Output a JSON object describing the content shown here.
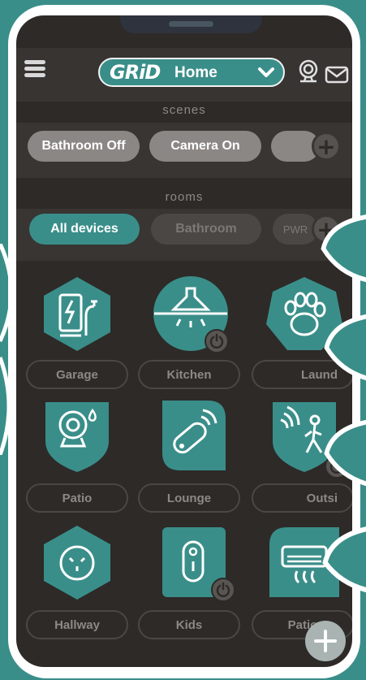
{
  "header": {
    "logo_text": "GRiD",
    "home_name": "Home",
    "menu_icon": "hamburger-menu-icon",
    "camera_icon": "webcam-icon",
    "mail_icon": "mail-icon"
  },
  "scenes": {
    "label": "scenes",
    "items": [
      {
        "label": "Bathroom Off"
      },
      {
        "label": "Camera On"
      },
      {
        "label": ""
      }
    ]
  },
  "rooms": {
    "label": "rooms",
    "filters": [
      {
        "label": "All devices",
        "active": true
      },
      {
        "label": "Bathroom",
        "active": false
      },
      {
        "label": "PWR",
        "active": false
      }
    ]
  },
  "devices": [
    {
      "room": "Garage",
      "icon": "ev-charger-icon",
      "shape": "hexagon",
      "power": false
    },
    {
      "room": "Kitchen",
      "icon": "range-hood-icon",
      "shape": "circle",
      "power": true
    },
    {
      "room": "Laundry",
      "display": "Laund",
      "icon": "pet-paw-icon",
      "shape": "heptagon",
      "power": true
    },
    {
      "room": "Patio",
      "icon": "security-camera-icon",
      "shape": "shield",
      "power": false
    },
    {
      "room": "Lounge",
      "icon": "remote-control-icon",
      "shape": "leaf",
      "power": false
    },
    {
      "room": "Outside",
      "display": "Outsi",
      "icon": "motion-sensor-icon",
      "shape": "shield",
      "power": true
    },
    {
      "room": "Hallway",
      "icon": "power-outlet-icon",
      "shape": "hexagon",
      "power": false
    },
    {
      "room": "Kids",
      "icon": "smart-plug-icon",
      "shape": "rounded-square",
      "power": true
    },
    {
      "room": "Patio",
      "icon": "air-conditioner-icon",
      "shape": "leaf",
      "power": false
    }
  ],
  "colors": {
    "accent": "#3a8e89",
    "background": "#2d2a28",
    "chip_grey": "#8a8785",
    "text_muted": "#8d8985"
  }
}
